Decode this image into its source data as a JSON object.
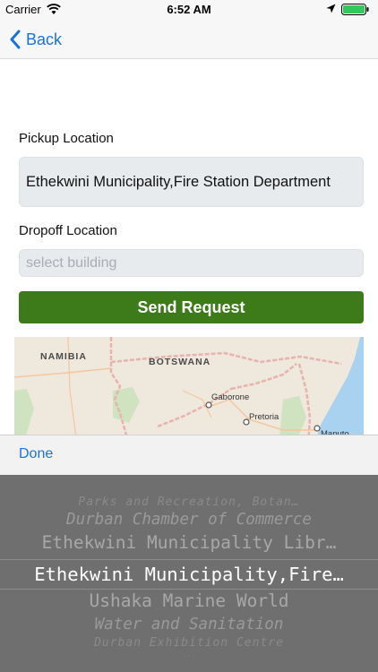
{
  "status_bar": {
    "carrier": "Carrier",
    "time": "6:52 AM"
  },
  "nav": {
    "back_label": "Back"
  },
  "form": {
    "pickup_label": "Pickup Location",
    "pickup_value": "Ethekwini Municipality,Fire Station Department",
    "dropoff_label": "Dropoff Location",
    "dropoff_placeholder": "select building",
    "send_label": "Send Request"
  },
  "map": {
    "labels": [
      "NAMIBIA",
      "BOTSWANA"
    ],
    "cities": [
      "Gaborone",
      "Pretoria",
      "Maputo"
    ]
  },
  "picker": {
    "done_label": "Done",
    "options": [
      "Parks and Recreation, Botan…",
      "Durban Chamber of Commerce",
      "Ethekwini Municipality Libr…",
      "Ethekwini Municipality,Fire…",
      "Ushaka Marine World",
      "Water and Sanitation",
      "Durban Exhibition Centre",
      "..."
    ],
    "selected_index": 3
  },
  "colors": {
    "accent": "#1a73d8",
    "send_button": "#3c7a1a",
    "picker_bg": "#6f6f6f"
  },
  "icons": [
    "wifi-icon",
    "location-arrow-icon",
    "battery-icon",
    "back-chevron-icon"
  ]
}
